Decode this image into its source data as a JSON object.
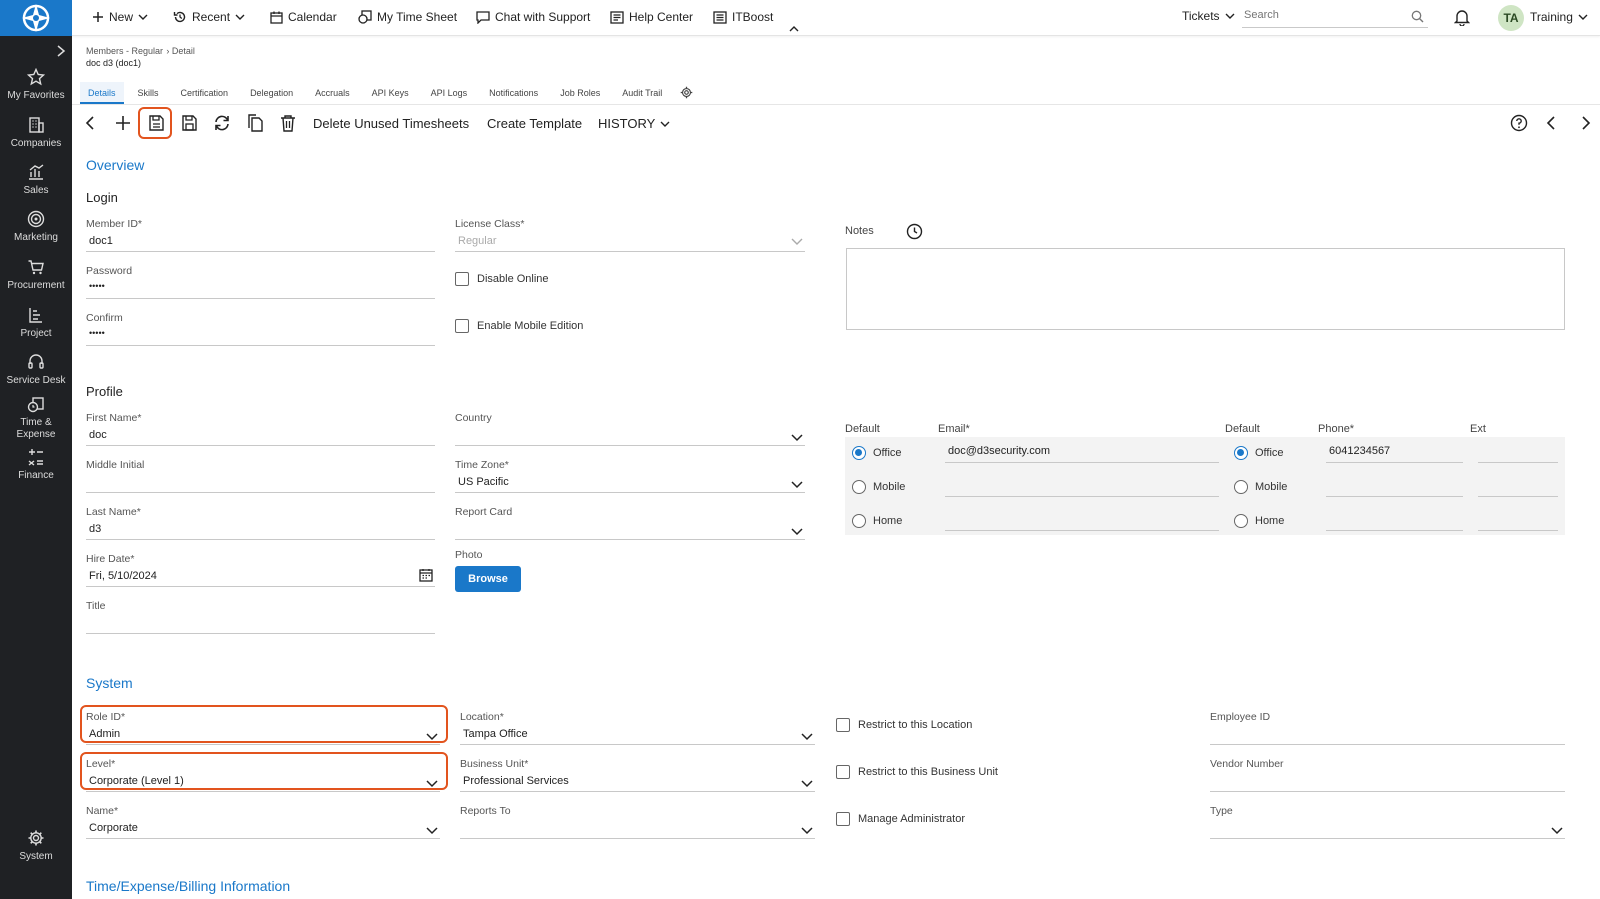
{
  "topbar": {
    "new_label": "New",
    "recent_label": "Recent",
    "calendar_label": "Calendar",
    "timesheet_label": "My Time Sheet",
    "chat_label": "Chat with Support",
    "help_label": "Help Center",
    "itboost_label": "ITBoost",
    "tickets_label": "Tickets",
    "search_placeholder": "Search",
    "avatar_initials": "TA",
    "user_label": "Training"
  },
  "sidebar": {
    "items": [
      {
        "label": "My Favorites",
        "icon": "star-icon"
      },
      {
        "label": "Companies",
        "icon": "building-icon"
      },
      {
        "label": "Sales",
        "icon": "chart-icon"
      },
      {
        "label": "Marketing",
        "icon": "target-icon"
      },
      {
        "label": "Procurement",
        "icon": "cart-icon"
      },
      {
        "label": "Project",
        "icon": "project-icon"
      },
      {
        "label": "Service Desk",
        "icon": "headset-icon"
      },
      {
        "label": "Time & Expense",
        "icon": "time-expense-icon"
      },
      {
        "label": "Finance",
        "icon": "finance-icon"
      },
      {
        "label": "System",
        "icon": "gear-icon"
      }
    ]
  },
  "breadcrumb": {
    "parent": "Members - Regular",
    "current": "Detail",
    "record": "doc d3 (doc1)"
  },
  "tabs": [
    "Details",
    "Skills",
    "Certification",
    "Delegation",
    "Accruals",
    "API Keys",
    "API Logs",
    "Notifications",
    "Job Roles",
    "Audit Trail"
  ],
  "toolbar": {
    "delete_unused": "Delete Unused Timesheets",
    "create_template": "Create Template",
    "history": "HISTORY"
  },
  "overview": {
    "title": "Overview",
    "login_title": "Login",
    "member_id_label": "Member ID*",
    "member_id_value": "doc1",
    "password_label": "Password",
    "password_value": "•••••",
    "confirm_label": "Confirm",
    "confirm_value": "•••••",
    "license_label": "License Class*",
    "license_value": "Regular",
    "disable_online": "Disable Online",
    "enable_mobile": "Enable Mobile Edition",
    "notes_label": "Notes"
  },
  "profile": {
    "title": "Profile",
    "first_name_label": "First Name*",
    "first_name_value": "doc",
    "middle_label": "Middle Initial",
    "last_name_label": "Last Name*",
    "last_name_value": "d3",
    "hire_label": "Hire Date*",
    "hire_value": "Fri, 5/10/2024",
    "title_label": "Title",
    "country_label": "Country",
    "tz_label": "Time Zone*",
    "tz_value": "US Pacific",
    "report_card_label": "Report Card",
    "photo_label": "Photo",
    "browse_label": "Browse",
    "email_default_label": "Default",
    "email_label": "Email*",
    "phone_default_label": "Default",
    "phone_label": "Phone*",
    "ext_label": "Ext",
    "rows": [
      {
        "type": "Office",
        "email": "doc@d3security.com",
        "phone": "6041234567"
      },
      {
        "type": "Mobile",
        "email": "",
        "phone": ""
      },
      {
        "type": "Home",
        "email": "",
        "phone": ""
      }
    ]
  },
  "system": {
    "title": "System",
    "role_label": "Role ID*",
    "role_value": "Admin",
    "level_label": "Level*",
    "level_value": "Corporate (Level 1)",
    "name_label": "Name*",
    "name_value": "Corporate",
    "location_label": "Location*",
    "location_value": "Tampa Office",
    "bu_label": "Business Unit*",
    "bu_value": "Professional Services",
    "reports_label": "Reports To",
    "restrict_location": "Restrict to this Location",
    "restrict_bu": "Restrict to this Business Unit",
    "manage_admin": "Manage Administrator",
    "employee_id_label": "Employee ID",
    "vendor_label": "Vendor Number",
    "type_label": "Type"
  },
  "time_expense": {
    "title": "Time/Expense/Billing Information"
  },
  "colors": {
    "accent": "#1a78c9",
    "sidebar": "#1f2124",
    "highlight": "#e2541e"
  }
}
